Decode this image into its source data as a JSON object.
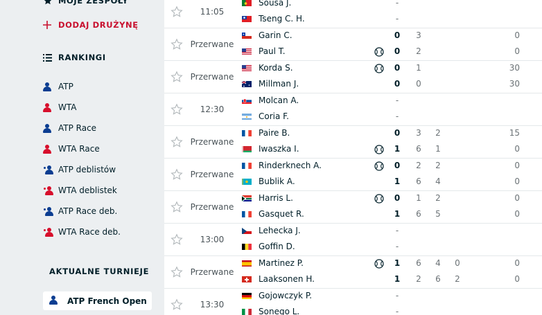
{
  "sidebar": {
    "my_teams_label": "MOJE ZESPOŁY",
    "add_team_label": "DODAJ DRUŻYNĘ",
    "rankings_label": "RANKINGI",
    "rankings": [
      {
        "label": "ATP",
        "tour": "atp",
        "doubles": false
      },
      {
        "label": "WTA",
        "tour": "wta",
        "doubles": false
      },
      {
        "label": "ATP Race",
        "tour": "atp",
        "doubles": false
      },
      {
        "label": "WTA Race",
        "tour": "wta",
        "doubles": false
      },
      {
        "label": "ATP deblistów",
        "tour": "atp",
        "doubles": true
      },
      {
        "label": "WTA deblistek",
        "tour": "wta",
        "doubles": true
      },
      {
        "label": "ATP Race deb.",
        "tour": "atp",
        "doubles": true
      },
      {
        "label": "WTA Race deb.",
        "tour": "wta",
        "doubles": true
      }
    ],
    "tournaments_label": "AKTUALNE TURNIEJE",
    "active_tournament": "ATP French Open",
    "colors": {
      "atp": "#0b3d91",
      "wta": "#d70f2c",
      "accent": "#c8102e"
    }
  },
  "matches": [
    {
      "time": "11:05",
      "players": [
        {
          "name": "Sousa J.",
          "flag": "pt",
          "serve": false,
          "score": "-",
          "sets": [],
          "points": ""
        },
        {
          "name": "Tseng C. H.",
          "flag": "tw",
          "serve": false,
          "score": "-",
          "sets": [],
          "points": ""
        }
      ]
    },
    {
      "time": "Przerwane",
      "players": [
        {
          "name": "Garin C.",
          "flag": "cl",
          "serve": false,
          "score": "0",
          "sets": [
            "3"
          ],
          "points": "0"
        },
        {
          "name": "Paul T.",
          "flag": "us",
          "serve": true,
          "score": "0",
          "sets": [
            "2"
          ],
          "points": "0"
        }
      ]
    },
    {
      "time": "Przerwane",
      "players": [
        {
          "name": "Korda S.",
          "flag": "us",
          "serve": true,
          "score": "0",
          "sets": [
            "1"
          ],
          "points": "30"
        },
        {
          "name": "Millman J.",
          "flag": "au",
          "serve": false,
          "score": "0",
          "sets": [
            "0"
          ],
          "points": "30"
        }
      ]
    },
    {
      "time": "12:30",
      "players": [
        {
          "name": "Molcan A.",
          "flag": "sk",
          "serve": false,
          "score": "-",
          "sets": [],
          "points": ""
        },
        {
          "name": "Coria F.",
          "flag": "ar",
          "serve": false,
          "score": "-",
          "sets": [],
          "points": ""
        }
      ]
    },
    {
      "time": "Przerwane",
      "players": [
        {
          "name": "Paire B.",
          "flag": "fr",
          "serve": false,
          "score": "0",
          "sets": [
            "3",
            "2"
          ],
          "points": "15"
        },
        {
          "name": "Iwaszka I.",
          "flag": "by",
          "serve": true,
          "score": "1",
          "sets": [
            "6",
            "1"
          ],
          "points": "0"
        }
      ]
    },
    {
      "time": "Przerwane",
      "players": [
        {
          "name": "Rinderknech A.",
          "flag": "fr",
          "serve": true,
          "score": "0",
          "sets": [
            "2",
            "2"
          ],
          "points": "0"
        },
        {
          "name": "Bublik A.",
          "flag": "kz",
          "serve": false,
          "score": "1",
          "sets": [
            "6",
            "4"
          ],
          "points": "0"
        }
      ]
    },
    {
      "time": "Przerwane",
      "players": [
        {
          "name": "Harris L.",
          "flag": "za",
          "serve": true,
          "score": "0",
          "sets": [
            "1",
            "2"
          ],
          "points": "0"
        },
        {
          "name": "Gasquet R.",
          "flag": "fr",
          "serve": false,
          "score": "1",
          "sets": [
            "6",
            "5"
          ],
          "points": "0"
        }
      ]
    },
    {
      "time": "13:00",
      "players": [
        {
          "name": "Lehecka J.",
          "flag": "cz",
          "serve": false,
          "score": "-",
          "sets": [],
          "points": ""
        },
        {
          "name": "Goffin D.",
          "flag": "be",
          "serve": false,
          "score": "-",
          "sets": [],
          "points": ""
        }
      ]
    },
    {
      "time": "Przerwane",
      "players": [
        {
          "name": "Martinez P.",
          "flag": "es",
          "serve": true,
          "score": "1",
          "sets": [
            "6",
            "4",
            "0"
          ],
          "points": "0"
        },
        {
          "name": "Laaksonen H.",
          "flag": "ch",
          "serve": false,
          "score": "1",
          "sets": [
            "2",
            "6",
            "2"
          ],
          "points": "0"
        }
      ]
    },
    {
      "time": "13:30",
      "players": [
        {
          "name": "Gojowczyk P.",
          "flag": "de",
          "serve": false,
          "score": "-",
          "sets": [],
          "points": ""
        },
        {
          "name": "Sonego L.",
          "flag": "it",
          "serve": false,
          "score": "-",
          "sets": [],
          "points": ""
        }
      ]
    }
  ]
}
